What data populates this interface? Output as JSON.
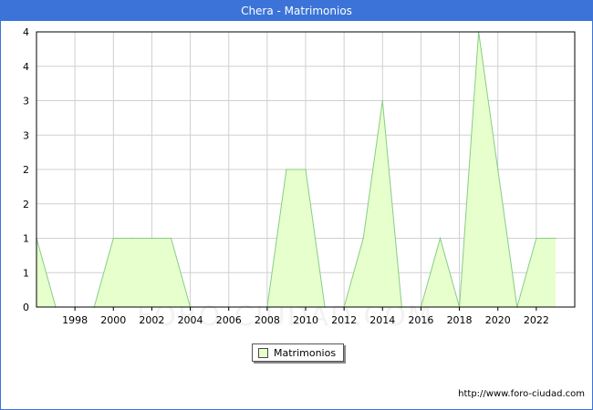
{
  "header": {
    "title": "Chera - Matrimonios"
  },
  "footer": {
    "source": "http://www.foro-ciudad.com"
  },
  "watermark": "FORO-CIUDAD.COM",
  "colors": {
    "header": "#3b73d8",
    "fill": "#e6ffcc",
    "line": "#88cc88",
    "grid": "#d0d0d0"
  },
  "chart_data": {
    "type": "area",
    "x": [
      1996,
      1997,
      1998,
      1999,
      2000,
      2001,
      2002,
      2003,
      2004,
      2005,
      2006,
      2007,
      2008,
      2009,
      2010,
      2011,
      2012,
      2013,
      2014,
      2015,
      2016,
      2017,
      2018,
      2019,
      2020,
      2021,
      2022,
      2023
    ],
    "series": [
      {
        "name": "Matrimonios",
        "values": [
          1,
          0,
          0,
          0,
          1,
          1,
          1,
          1,
          0,
          0,
          0,
          0,
          0,
          2,
          2,
          0,
          0,
          1,
          3,
          0,
          0,
          1,
          0,
          4,
          2,
          0,
          1,
          1
        ]
      }
    ],
    "xticks": [
      "1998",
      "2000",
      "2002",
      "2004",
      "2006",
      "2008",
      "2010",
      "2012",
      "2014",
      "2016",
      "2018",
      "2020",
      "2022"
    ],
    "yticks": [
      "0",
      "1",
      "1",
      "2",
      "2",
      "3",
      "3",
      "4",
      "4"
    ],
    "xlim": [
      1996,
      2024
    ],
    "ylim": [
      0,
      4
    ],
    "grid": true,
    "legend": "bottom-center"
  }
}
